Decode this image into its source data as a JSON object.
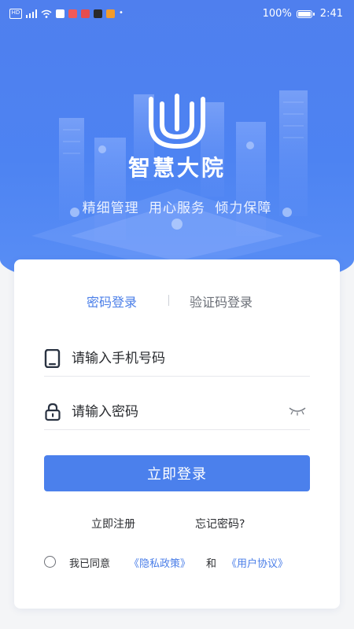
{
  "status_bar": {
    "battery_text": "100%",
    "time": "2:41",
    "icons": [
      "hd-icon",
      "signal-4g-icon",
      "wifi-icon",
      "puzzle-icon",
      "app-notification-icons"
    ]
  },
  "app": {
    "title": "智慧大院",
    "slogan": "精细管理  用心服务  倾力保障"
  },
  "login": {
    "tabs": [
      {
        "label": "密码登录",
        "active": true
      },
      {
        "label": "验证码登录",
        "active": false
      }
    ],
    "phone_placeholder": "请输入手机号码",
    "password_placeholder": "请输入密码",
    "submit_label": "立即登录",
    "register_label": "立即注册",
    "forgot_label": "忘记密码?",
    "agree": {
      "prefix": "我已同意",
      "privacy": "《隐私政策》",
      "and": "和",
      "user_agreement": "《用户协议》",
      "checked": false
    }
  },
  "colors": {
    "primary": "#4b80ec",
    "hero_bg": "#4f7fee",
    "link": "#4a7ee8"
  }
}
